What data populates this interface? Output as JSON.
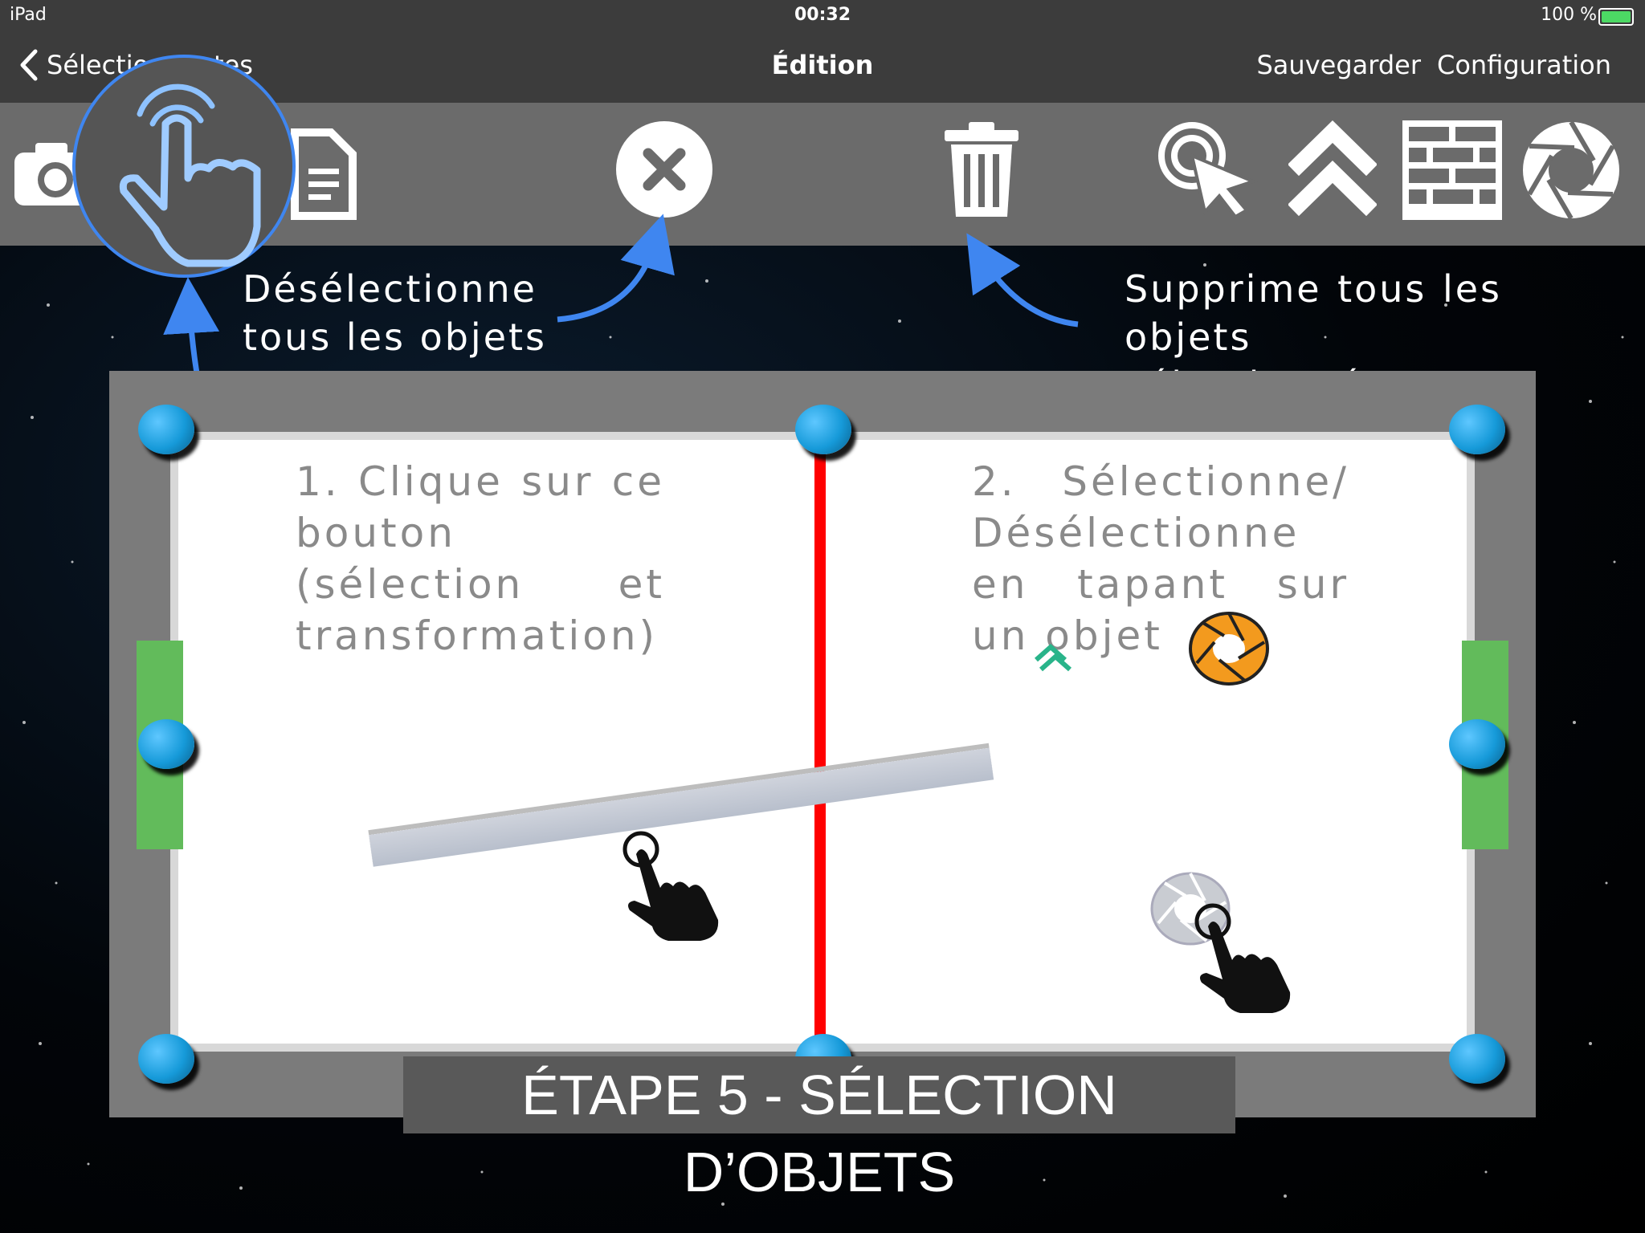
{
  "status_bar": {
    "device": "iPad",
    "time": "00:32",
    "battery": "100 %",
    "battery_level": 1.0
  },
  "nav": {
    "back_label": "Sélection cartes",
    "title": "Édition",
    "save_label": "Sauvegarder",
    "config_label": "Configuration"
  },
  "toolbar": {
    "icons": [
      "camera-icon",
      "hand-tap-icon",
      "document-icon",
      "close-circle-icon",
      "trash-icon",
      "click-cursor-icon",
      "double-chevron-up-icon",
      "brick-wall-icon",
      "aperture-icon"
    ]
  },
  "callouts": {
    "deselect": "Désélectionne tous les objets",
    "delete": "Supprime tous les objets sélectionnés"
  },
  "instructions": {
    "step1": "1. Clique sur ce bouton (sélection et transformation)",
    "step2": "2. Sélectionne/ Désélectionne en tapant sur un objet"
  },
  "caption": "ÉTAPE 5 - SÉLECTION D’OBJETS",
  "colors": {
    "accent_blue": "#3f86f0",
    "goal_green": "#62bb5b",
    "center_red": "#ff0000",
    "aperture_orange": "#f39a1e",
    "booster_green": "#29b48a"
  }
}
